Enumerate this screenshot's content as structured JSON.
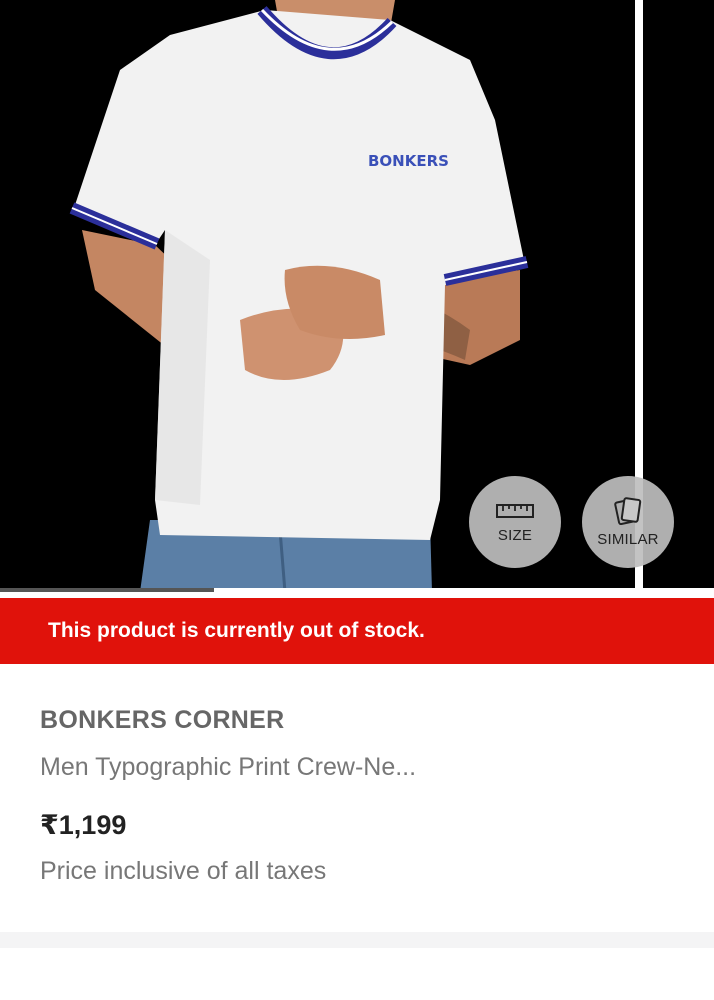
{
  "gallery": {
    "image_alt": "Model wearing white crew-neck t-shirt with blue ribbed trims",
    "shirt_logo_text": "BONKERS",
    "slide_progress": 0.3,
    "actions": {
      "size_label": "SIZE",
      "similar_label": "SIMILAR"
    }
  },
  "status": {
    "out_of_stock_message": "This product is currently out of stock."
  },
  "product": {
    "brand": "BONKERS CORNER",
    "title": "Men Typographic Print Crew-Ne...",
    "price": "₹1,199",
    "tax_note": "Price inclusive of all taxes"
  },
  "colors": {
    "banner": "#e0120b",
    "trim_blue": "#2b2f9a"
  }
}
